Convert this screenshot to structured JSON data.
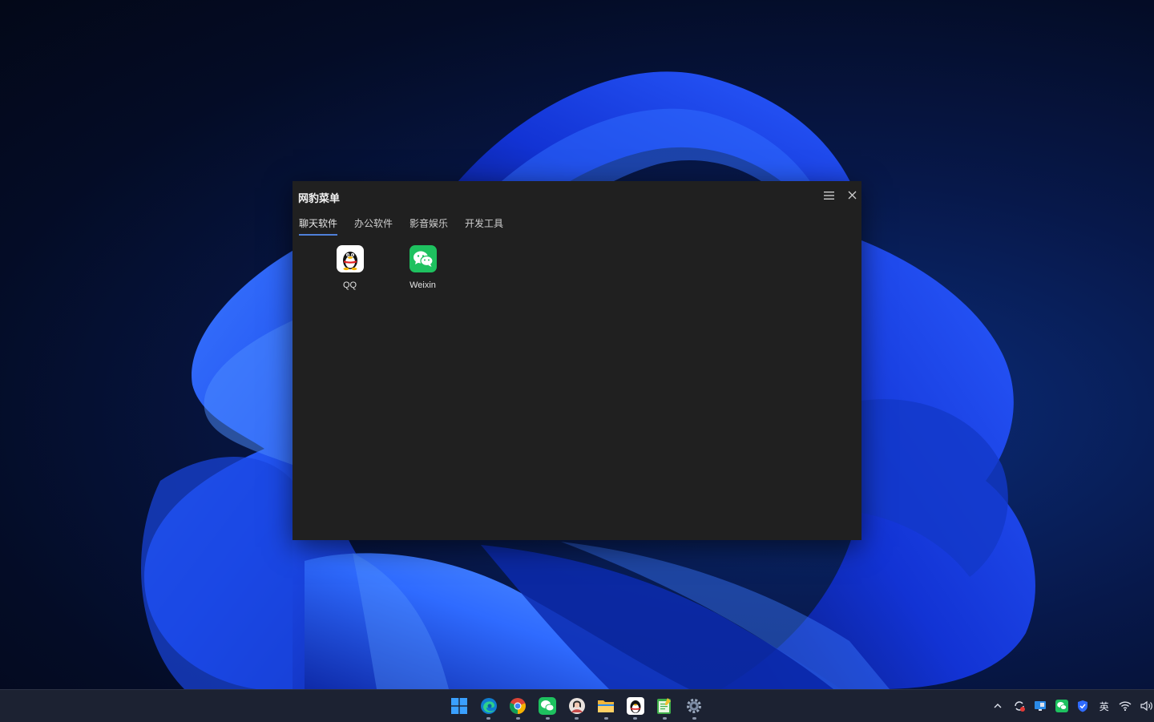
{
  "window": {
    "title": "网豹菜单",
    "tabs": [
      {
        "label": "聊天软件",
        "active": true
      },
      {
        "label": "办公软件",
        "active": false
      },
      {
        "label": "影音娱乐",
        "active": false
      },
      {
        "label": "开发工具",
        "active": false
      }
    ],
    "apps": [
      {
        "label": "QQ",
        "icon": "qq-penguin-icon"
      },
      {
        "label": "Weixin",
        "icon": "wechat-icon"
      }
    ],
    "controls": {
      "menu_icon": "hamburger-menu-icon",
      "close_icon": "close-icon"
    }
  },
  "taskbar": {
    "pinned": [
      {
        "name": "start-button",
        "icon": "windows-logo-icon",
        "running": false
      },
      {
        "name": "taskbar-edge",
        "icon": "edge-icon",
        "running": true
      },
      {
        "name": "taskbar-chrome",
        "icon": "chrome-icon",
        "running": true
      },
      {
        "name": "taskbar-wechat",
        "icon": "wechat-icon",
        "running": true
      },
      {
        "name": "taskbar-avatar-app",
        "icon": "avatar-app-icon",
        "running": true
      },
      {
        "name": "taskbar-file-explorer",
        "icon": "folder-icon",
        "running": true
      },
      {
        "name": "taskbar-qq",
        "icon": "qq-penguin-icon",
        "running": true
      },
      {
        "name": "taskbar-notepad-app",
        "icon": "notepad-icon",
        "running": true
      },
      {
        "name": "taskbar-settings",
        "icon": "gear-icon",
        "running": true
      }
    ],
    "tray": {
      "language_indicator": "英",
      "icons": [
        "chevron-up-icon",
        "sync-icon",
        "remote-desktop-icon",
        "wechat-tray-icon",
        "security-shield-icon",
        "wifi-icon",
        "volume-icon"
      ]
    }
  },
  "colors": {
    "window_bg": "#202020",
    "tab_underline": "#4f7fd9",
    "wechat_green": "#1ec15f",
    "taskbar_bg": "#1c2232"
  }
}
